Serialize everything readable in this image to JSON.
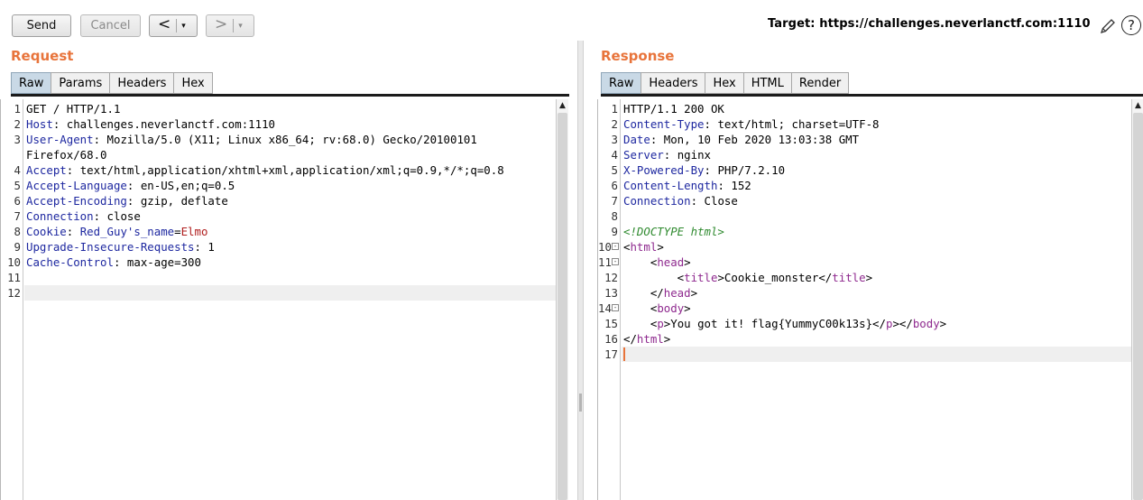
{
  "toolbar": {
    "send": "Send",
    "cancel": "Cancel",
    "back": "<",
    "forward": ">",
    "dropdown": "▾",
    "target": "Target: https://challenges.neverlanctf.com:1110",
    "help": "?"
  },
  "request": {
    "title": "Request",
    "tabs": [
      "Raw",
      "Params",
      "Headers",
      "Hex"
    ],
    "active_tab": "Raw",
    "lines": [
      {
        "n": "1",
        "k": "",
        "sep": "",
        "v": "GET / HTTP/1.1"
      },
      {
        "n": "2",
        "k": "Host",
        "sep": ": ",
        "v": "challenges.neverlanctf.com:1110"
      },
      {
        "n": "3",
        "k": "User-Agent",
        "sep": ": ",
        "v": "Mozilla/5.0 (X11; Linux x86_64; rv:68.0) Gecko/20100101"
      },
      {
        "n": "",
        "k": "",
        "sep": "",
        "v": "Firefox/68.0"
      },
      {
        "n": "4",
        "k": "Accept",
        "sep": ": ",
        "v": "text/html,application/xhtml+xml,application/xml;q=0.9,*/*;q=0.8"
      },
      {
        "n": "5",
        "k": "Accept-Language",
        "sep": ": ",
        "v": "en-US,en;q=0.5"
      },
      {
        "n": "6",
        "k": "Accept-Encoding",
        "sep": ": ",
        "v": "gzip, deflate"
      },
      {
        "n": "7",
        "k": "Connection",
        "sep": ": ",
        "v": "close"
      },
      {
        "n": "8",
        "k": "Cookie",
        "sep": ": ",
        "v": "",
        "cookie_name": "Red_Guy's_name",
        "cookie_eq": "=",
        "cookie_val": "Elmo"
      },
      {
        "n": "9",
        "k": "Upgrade-Insecure-Requests",
        "sep": ": ",
        "v": "1"
      },
      {
        "n": "10",
        "k": "Cache-Control",
        "sep": ": ",
        "v": "max-age=300"
      },
      {
        "n": "11",
        "k": "",
        "sep": "",
        "v": ""
      },
      {
        "n": "12",
        "k": "",
        "sep": "",
        "v": ""
      }
    ]
  },
  "response": {
    "title": "Response",
    "tabs": [
      "Raw",
      "Headers",
      "Hex",
      "HTML",
      "Render"
    ],
    "active_tab": "Raw",
    "header_lines": [
      {
        "n": "1",
        "k": "",
        "sep": "",
        "v": "HTTP/1.1 200 OK"
      },
      {
        "n": "2",
        "k": "Content-Type",
        "sep": ": ",
        "v": "text/html; charset=UTF-8"
      },
      {
        "n": "3",
        "k": "Date",
        "sep": ": ",
        "v": "Mon, 10 Feb 2020 13:03:38 GMT"
      },
      {
        "n": "4",
        "k": "Server",
        "sep": ": ",
        "v": "nginx"
      },
      {
        "n": "5",
        "k": "X-Powered-By",
        "sep": ": ",
        "v": "PHP/7.2.10"
      },
      {
        "n": "6",
        "k": "Content-Length",
        "sep": ": ",
        "v": "152"
      },
      {
        "n": "7",
        "k": "Connection",
        "sep": ": ",
        "v": "Close"
      },
      {
        "n": "8",
        "k": "",
        "sep": "",
        "v": ""
      }
    ],
    "body_lines": [
      {
        "n": "9",
        "fold": "",
        "segs": [
          {
            "t": "<!DOCTYPE html>",
            "c": "cm"
          }
        ]
      },
      {
        "n": "10",
        "fold": "⊟",
        "segs": [
          {
            "t": "<",
            "c": ""
          },
          {
            "t": "html",
            "c": "tg"
          },
          {
            "t": ">",
            "c": ""
          }
        ]
      },
      {
        "n": "11",
        "fold": "⊟",
        "segs": [
          {
            "t": "    <",
            "c": ""
          },
          {
            "t": "head",
            "c": "tg"
          },
          {
            "t": ">",
            "c": ""
          }
        ]
      },
      {
        "n": "12",
        "fold": "",
        "segs": [
          {
            "t": "        <",
            "c": ""
          },
          {
            "t": "title",
            "c": "tg"
          },
          {
            "t": ">Cookie_monster</",
            "c": ""
          },
          {
            "t": "title",
            "c": "tg"
          },
          {
            "t": ">",
            "c": ""
          }
        ]
      },
      {
        "n": "13",
        "fold": "",
        "segs": [
          {
            "t": "    </",
            "c": ""
          },
          {
            "t": "head",
            "c": "tg"
          },
          {
            "t": ">",
            "c": ""
          }
        ]
      },
      {
        "n": "14",
        "fold": "⊟",
        "segs": [
          {
            "t": "    <",
            "c": ""
          },
          {
            "t": "body",
            "c": "tg"
          },
          {
            "t": ">",
            "c": ""
          }
        ]
      },
      {
        "n": "15",
        "fold": "",
        "segs": [
          {
            "t": "    <",
            "c": ""
          },
          {
            "t": "p",
            "c": "tg"
          },
          {
            "t": ">You got it! flag{YummyC00k13s}</",
            "c": ""
          },
          {
            "t": "p",
            "c": "tg"
          },
          {
            "t": "></",
            "c": ""
          },
          {
            "t": "body",
            "c": "tg"
          },
          {
            "t": ">",
            "c": ""
          }
        ]
      },
      {
        "n": "16",
        "fold": "",
        "segs": [
          {
            "t": "</",
            "c": ""
          },
          {
            "t": "html",
            "c": "tg"
          },
          {
            "t": ">",
            "c": ""
          }
        ]
      },
      {
        "n": "17",
        "fold": "",
        "segs": []
      }
    ]
  },
  "colors": {
    "accent": "#e8743b",
    "header_key": "#1e28a0",
    "tag": "#8f2a8f",
    "cookie_value": "#b01e1e",
    "doctype": "#2f8a2f"
  }
}
